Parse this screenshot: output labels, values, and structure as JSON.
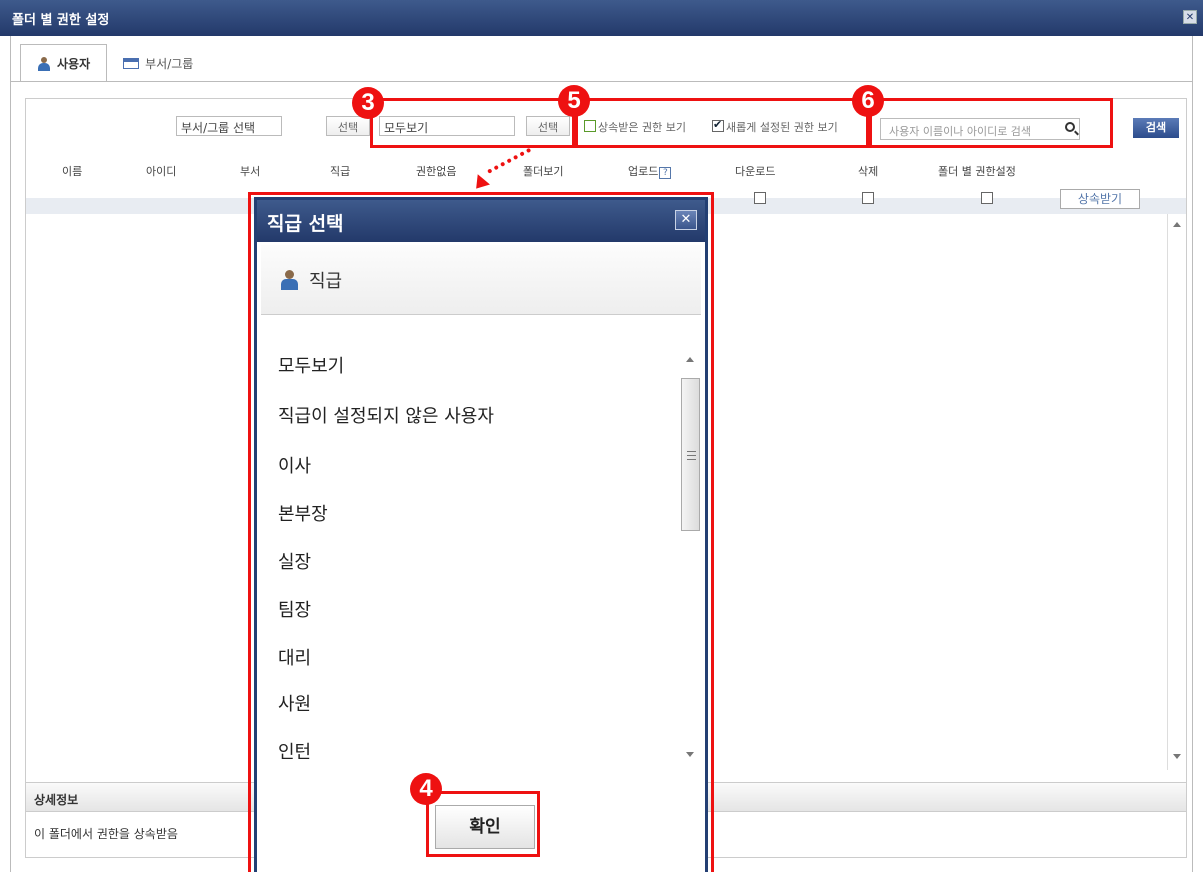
{
  "window": {
    "title": "폴더 별 권한 설정"
  },
  "tabs": [
    {
      "label": "사용자"
    },
    {
      "label": "부서/그룹"
    }
  ],
  "filters": {
    "dept_select_value": "부서/그룹 선택",
    "dept_select_button": "선택",
    "rank_value": "모두보기",
    "rank_select_button": "선택",
    "show_inherited_label": "상속받은 권한 보기",
    "show_inherited_checked": false,
    "show_new_label": "새롭게 설정된 권한 보기",
    "show_new_checked": true,
    "search_placeholder": "사용자 이름이나 아이디로 검색",
    "search_button": "검색"
  },
  "table": {
    "columns": [
      "이름",
      "아이디",
      "부서",
      "직급",
      "권한없음",
      "폴더보기",
      "업로드",
      "다운로드",
      "삭제",
      "폴더 별 권한설정"
    ],
    "inherit_button": "상속받기"
  },
  "detail": {
    "header": "상세정보",
    "text": "이 폴더에서 권한을 상속받음"
  },
  "modal": {
    "title": "직급 선택",
    "header": "직급",
    "options": [
      "모두보기",
      "직급이 설정되지 않은 사용자",
      "이사",
      "본부장",
      "실장",
      "팀장",
      "대리",
      "사원",
      "인턴"
    ],
    "ok_button": "확인"
  },
  "annotations": {
    "badge3": "3",
    "badge4": "4",
    "badge5": "5",
    "badge6": "6"
  },
  "colors": {
    "title_bar": "#2c4575",
    "highlight": "#ee1111",
    "search_button": "#3a5a9a"
  }
}
